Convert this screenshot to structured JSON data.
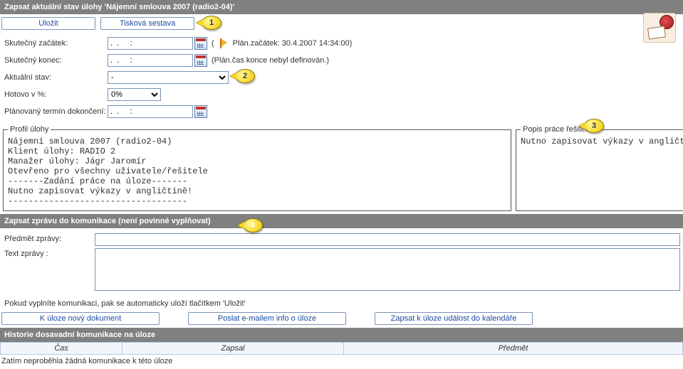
{
  "header": {
    "title": "Zapsat aktuální stav úlohy 'Nájemní smlouva 2007 (radio2-04)'"
  },
  "toolbar": {
    "save_label": "Uložit",
    "print_label": "Tisková sestava"
  },
  "form": {
    "start_label": "Skutečný začátek:",
    "start_value": ".  .     :",
    "start_hint_prefix": "(",
    "start_hint": "Plán.začátek: 30.4.2007 14:34:00)",
    "end_label": "Skutečný konec:",
    "end_value": ".  .     :",
    "end_hint": "(Plán.čas konce nebyl definován.)",
    "state_label": "Aktuální stav:",
    "state_value": "-",
    "pct_label": "Hotovo v %:",
    "pct_value": "0%",
    "planned_label": "Plánovaný termín dokončení:",
    "planned_value": ".  .     :"
  },
  "profile": {
    "legend": "Profil úlohy",
    "text": "Nájemní smlouva 2007 (radio2-04)\nKlient úlohy: RADIO 2\nManažer úlohy: Jágr Jaromír\nOtevřeno pro všechny uživatele/řešitele\n-------Zadání práce na úloze-------\nNutno zapisovat výkazy v angličtině!\n-----------------------------------"
  },
  "desc": {
    "legend": "Popis práce řešitelů",
    "text": "Nutno zapisovat výkazy v angličtině!"
  },
  "message": {
    "section_title": "Zapsat zprávu do komunikace (není povinné vyplňovat)",
    "subject_label": "Předmět zprávy:",
    "subject_value": "",
    "body_label": "Text zprávy :",
    "body_value": "",
    "note": "Pokud vyplníte komunikaci, pak se automaticky uloží tlačítkem 'Uložit'"
  },
  "buttons": {
    "new_doc": "K úloze nový dokument",
    "send_mail": "Poslat e-mailem info o úloze",
    "calendar_event": "Zapsat k úloze událost do kalendáře"
  },
  "history": {
    "title": "Historie dosavadní komunikace na úloze",
    "col_time": "Čas",
    "col_user": "Zapsal",
    "col_subject": "Předmět",
    "empty": "Zatím neproběhla žádná komunikace k této úloze"
  },
  "callouts": {
    "c1": "1",
    "c2": "2",
    "c3": "3",
    "c4": "4"
  }
}
